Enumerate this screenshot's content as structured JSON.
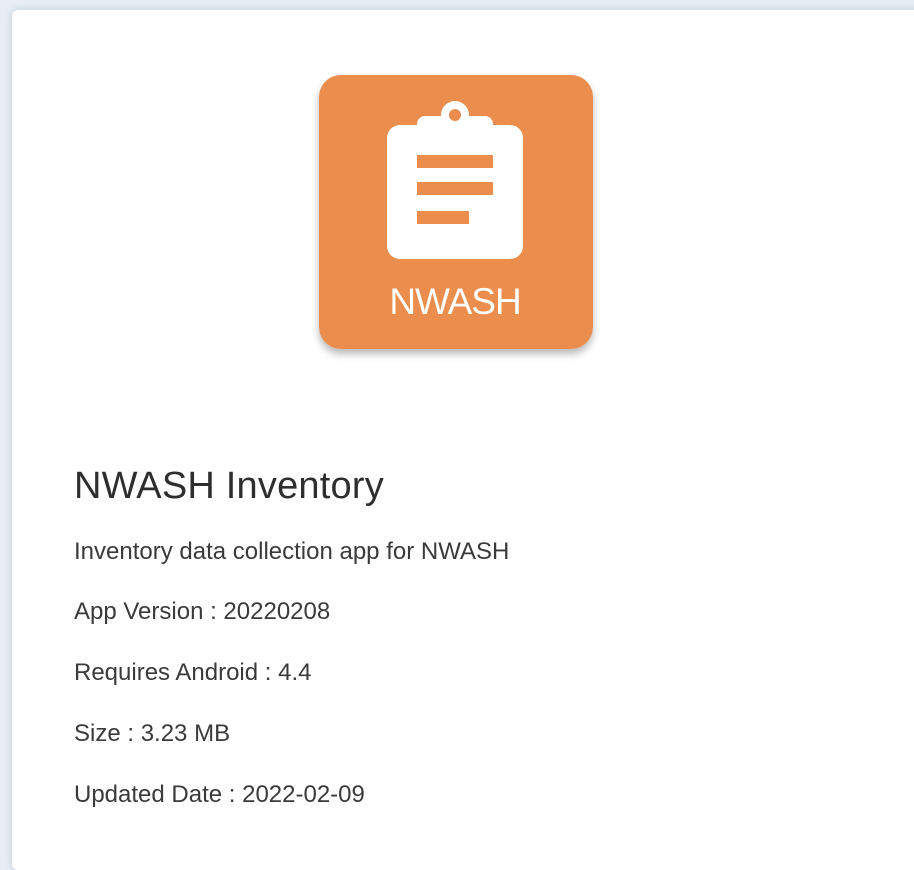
{
  "app": {
    "icon": {
      "name": "clipboard-icon",
      "label": "NWASH",
      "background_color": "#ea8d4d",
      "foreground_color": "#ffffff"
    },
    "name": "NWASH Inventory",
    "description": "Inventory data collection app for NWASH",
    "details": {
      "version": "App Version : 20220208",
      "requires_android": "Requires Android : 4.4",
      "size": "Size : 3.23 MB",
      "updated_date": "Updated Date : 2022-02-09"
    }
  }
}
